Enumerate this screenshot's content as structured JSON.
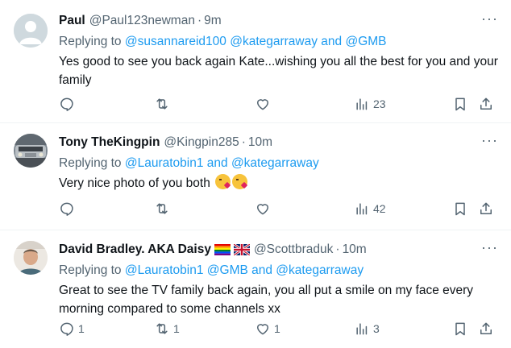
{
  "tweets": [
    {
      "name": "Paul",
      "handle": "@Paul123newman",
      "time": "9m",
      "reply_prefix": "Replying to ",
      "reply_to": "@susannareid100 @kategarraway and @GMB",
      "text": "Yes good to see you back again Kate...wishing you all the best for you and your family",
      "replies": "",
      "retweets": "",
      "likes": "",
      "views": "23"
    },
    {
      "name": "Tony TheKingpin",
      "handle": "@Kingpin285",
      "time": "10m",
      "reply_prefix": "Replying to ",
      "reply_to": "@Lauratobin1 and @kategarraway",
      "text": "Very nice photo of you both",
      "emojis": [
        "kiss-emoji",
        "kiss-emoji"
      ],
      "replies": "",
      "retweets": "",
      "likes": "",
      "views": "42"
    },
    {
      "name": "David Bradley. AKA Daisy",
      "flags": [
        "rainbow-flag-icon",
        "union-jack-flag-icon"
      ],
      "handle": "@Scottbraduk",
      "time": "10m",
      "reply_prefix": "Replying to ",
      "reply_to": "@Lauratobin1 @GMB and @kategarraway",
      "text": "Great to see the TV family back again, you all put a smile on my face every morning compared to some channels xx",
      "replies": "1",
      "retweets": "1",
      "likes": "1",
      "views": "3"
    }
  ],
  "ui": {
    "separator": "·",
    "more": "···"
  },
  "colors": {
    "text": "#0f1419",
    "secondary": "#536471",
    "link": "#1d9bf0",
    "divider": "#eff3f4"
  }
}
